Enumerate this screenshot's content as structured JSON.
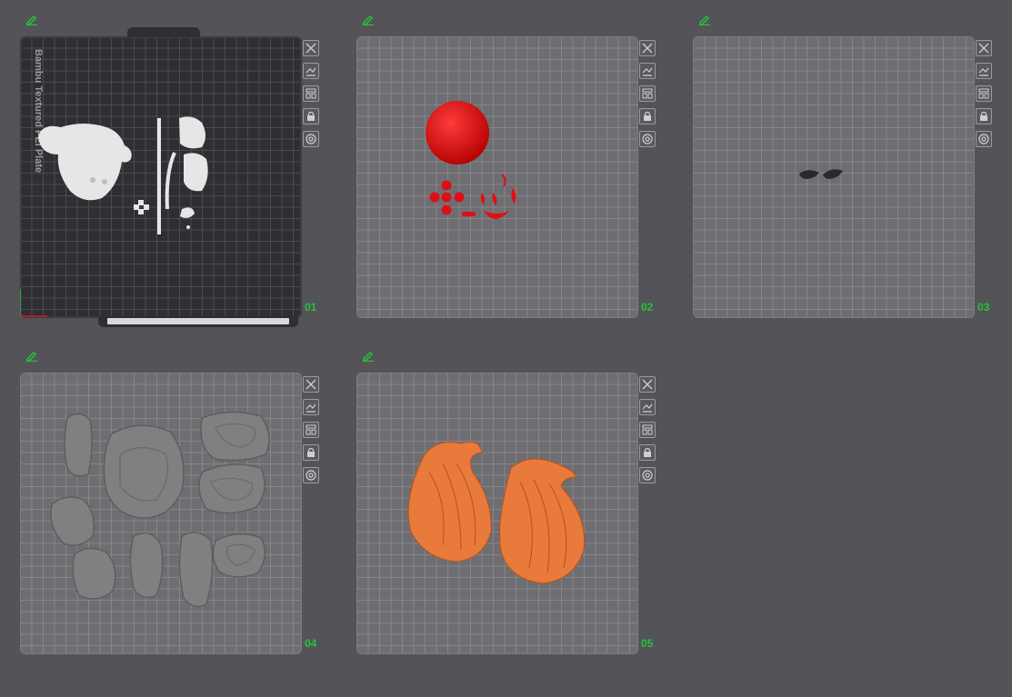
{
  "plates": [
    {
      "number": "01",
      "label": "Bambu Textured PEI Plate",
      "theme": "dark"
    },
    {
      "number": "02",
      "theme": "light"
    },
    {
      "number": "03",
      "theme": "light"
    },
    {
      "number": "04",
      "theme": "light"
    },
    {
      "number": "05",
      "theme": "light"
    }
  ],
  "plate_tools": [
    "close-icon",
    "auto-orient-icon",
    "arrange-icon",
    "lock-icon",
    "settings-icon"
  ],
  "colors": {
    "background": "#545358",
    "plate_number": "#27c13c",
    "edit_icon": "#27c13c",
    "model_white": "#e6e6e6",
    "model_red": "#dd1016",
    "model_dark": "#2a2a2a",
    "model_grey": "#808080",
    "model_orange": "#e87a3c"
  }
}
